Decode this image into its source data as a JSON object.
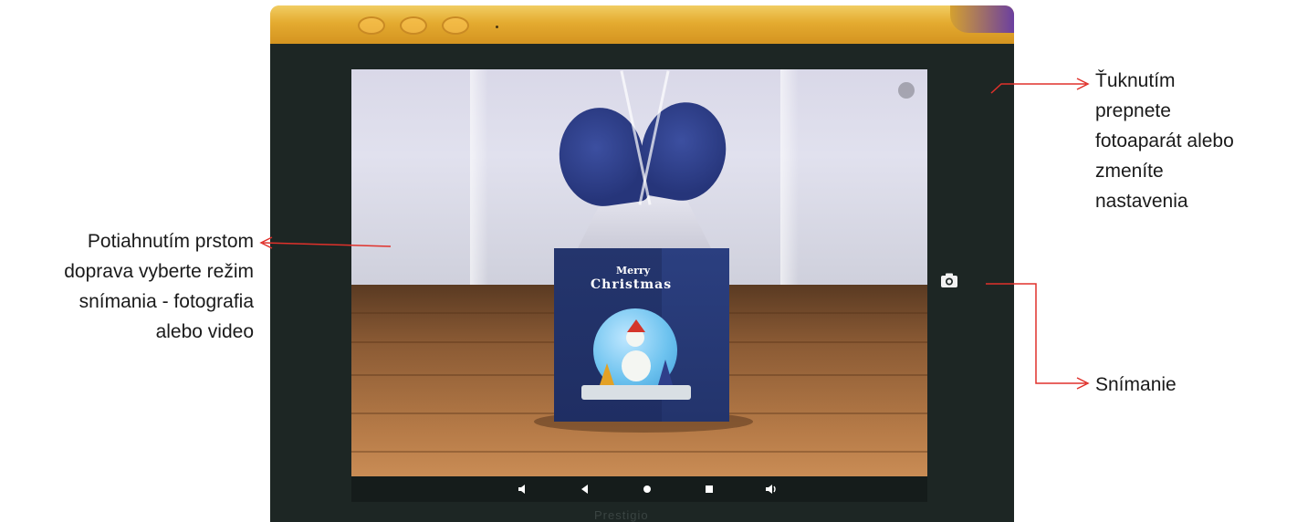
{
  "annotations": {
    "swipe_mode": [
      "Potiahnutím prstom",
      "doprava vyberte režim",
      "snímania - fotografia",
      "alebo video"
    ],
    "settings": [
      "Ťuknutím",
      "prepnete",
      "fotoaparát alebo",
      "zmeníte",
      "nastavenia"
    ],
    "capture": [
      "Snímanie"
    ]
  },
  "scene": {
    "box_text_line1": "Merry",
    "box_text_line2": "Christmas"
  },
  "colors": {
    "arrow": "#e0312b",
    "tablet_frame": "#e4ab30",
    "bezel": "#1d2624",
    "box": "#24356d"
  },
  "icons": {
    "settings": "switch-camera-icon",
    "capture": "camera-icon",
    "nav": [
      "volume-down-icon",
      "back-icon",
      "home-icon",
      "recents-icon",
      "volume-up-icon"
    ]
  }
}
